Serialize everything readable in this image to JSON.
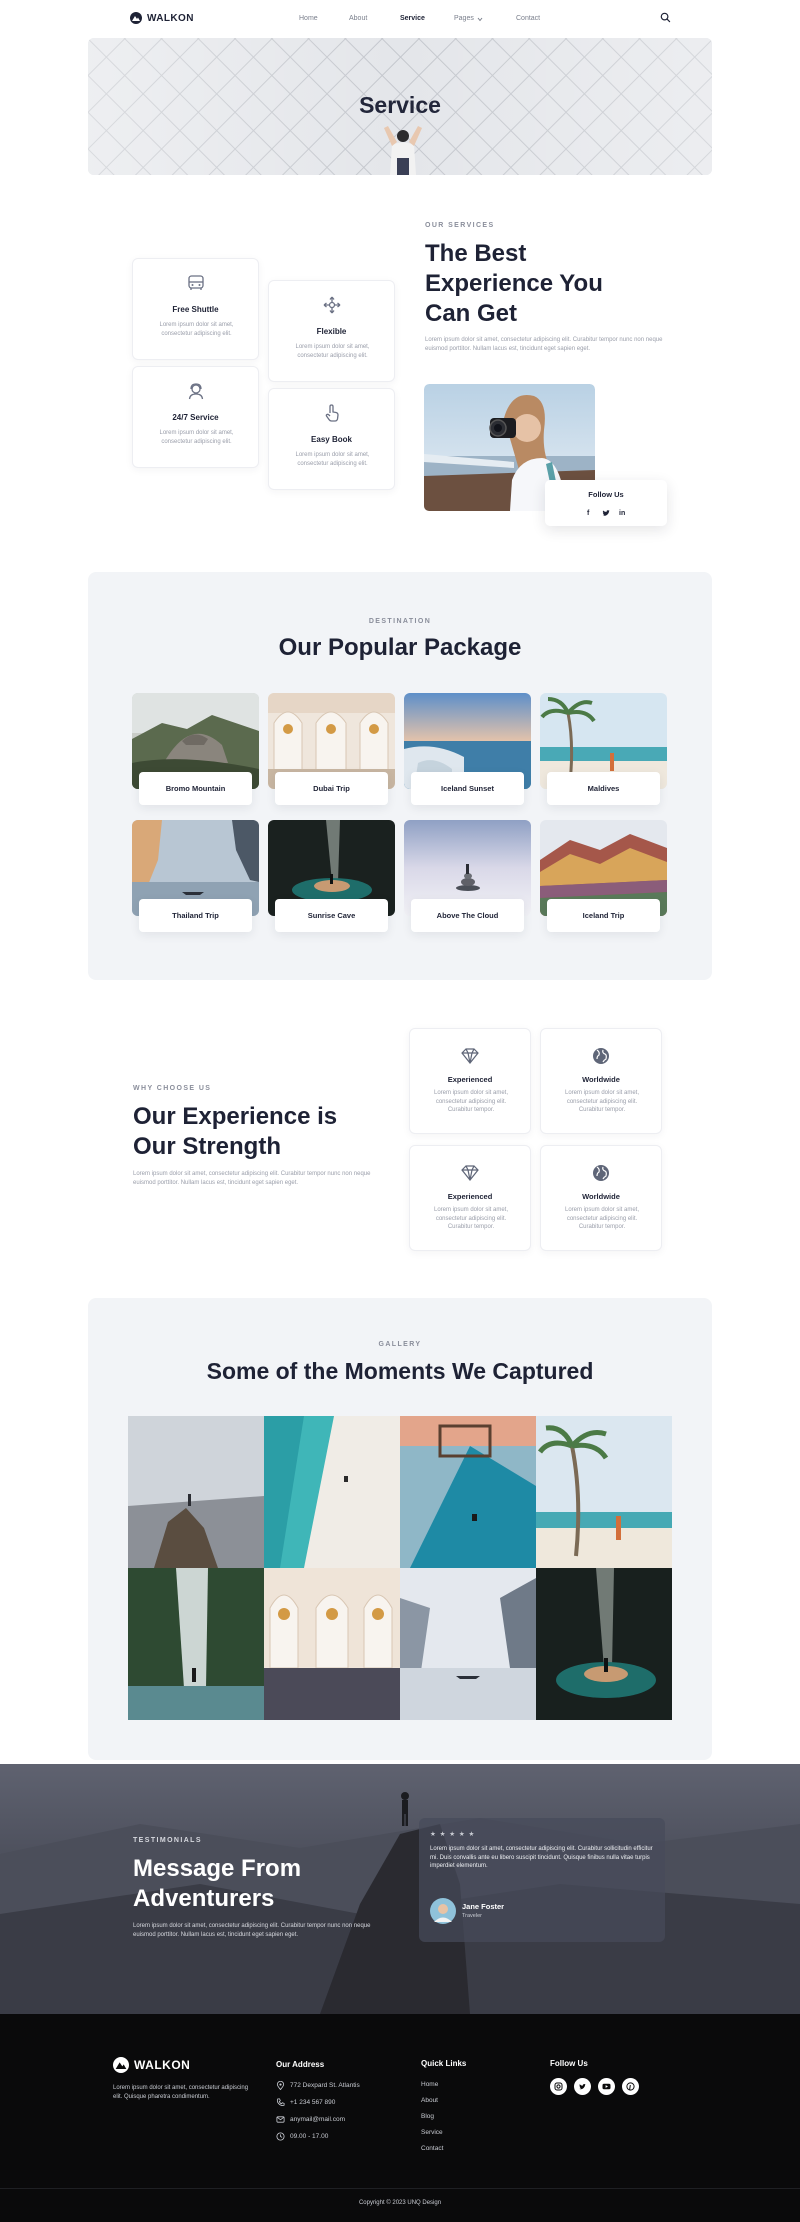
{
  "brand": {
    "name": "WALKON"
  },
  "nav": {
    "items": [
      "Home",
      "About",
      "Service",
      "Pages",
      "Contact"
    ],
    "active": "Service"
  },
  "hero": {
    "title": "Service"
  },
  "services": {
    "eyebrow": "OUR SERVICES",
    "title_lines": [
      "The Best",
      "Experience You",
      "Can Get"
    ],
    "description": "Lorem ipsum dolor sit amet, consectetur adipiscing elit. Curabitur tempor nunc non neque euismod porttitor. Nullam lacus est, tincidunt eget sapien eget.",
    "cards": [
      {
        "title": "Free Shuttle",
        "desc": "Lorem ipsum dolor sit amet, consectetur adipiscing elit.",
        "icon": "bus-icon"
      },
      {
        "title": "Flexible",
        "desc": "Lorem ipsum dolor sit amet, consectetur adipiscing elit.",
        "icon": "flexible-icon"
      },
      {
        "title": "24/7 Service",
        "desc": "Lorem ipsum dolor sit amet, consectetur adipiscing elit.",
        "icon": "support-agent-icon"
      },
      {
        "title": "Easy Book",
        "desc": "Lorem ipsum dolor sit amet, consectetur adipiscing elit.",
        "icon": "hand-tap-icon"
      }
    ],
    "follow": {
      "title": "Follow Us",
      "socials": [
        "f",
        "t",
        "in"
      ]
    }
  },
  "packages": {
    "eyebrow": "DESTINATION",
    "title": "Our Popular Package",
    "items": [
      "Bromo Mountain",
      "Dubai Trip",
      "Iceland Sunset",
      "Maldives",
      "Thailand Trip",
      "Sunrise Cave",
      "Above The Cloud",
      "Iceland Trip"
    ]
  },
  "why": {
    "eyebrow": "WHY CHOOSE US",
    "title_lines": [
      "Our Experience is",
      "Our Strength"
    ],
    "description": "Lorem ipsum dolor sit amet, consectetur adipiscing elit. Curabitur tempor nunc non neque euismod porttitor. Nullam lacus est, tincidunt eget sapien eget.",
    "cards": [
      {
        "title": "Experienced",
        "desc": "Lorem ipsum dolor sit amet, consectetur adipiscing elit. Curabitur tempor.",
        "icon": "diamond-icon"
      },
      {
        "title": "Worldwide",
        "desc": "Lorem ipsum dolor sit amet, consectetur adipiscing elit. Curabitur tempor.",
        "icon": "globe-icon"
      },
      {
        "title": "Experienced",
        "desc": "Lorem ipsum dolor sit amet, consectetur adipiscing elit. Curabitur tempor.",
        "icon": "diamond-icon"
      },
      {
        "title": "Worldwide",
        "desc": "Lorem ipsum dolor sit amet, consectetur adipiscing elit. Curabitur tempor.",
        "icon": "globe-icon"
      }
    ]
  },
  "gallery": {
    "eyebrow": "GALLERY",
    "title": "Some of the Moments We Captured"
  },
  "testimonials": {
    "eyebrow": "TESTIMONIALS",
    "title_lines": [
      "Message From",
      "Adventurers"
    ],
    "description": "Lorem ipsum dolor sit amet, consectetur adipiscing elit. Curabitur tempor nunc non neque euismod porttitor. Nullam lacus est, tincidunt eget sapien eget.",
    "stars": "★ ★ ★ ★ ★",
    "quote": "Lorem ipsum dolor sit amet, consectetur adipiscing elit. Curabitur sollicitudin efficitur mi. Duis convallis ante eu libero suscipit tincidunt. Quisque finibus nulla vitae turpis imperdiet elementum.",
    "author": "Jane Foster",
    "role": "Traveler"
  },
  "footer": {
    "brand_description": "Lorem ipsum dolor sit amet, consectetur adipiscing elit. Quisque pharetra condimentum.",
    "address_title": "Our Address",
    "address": [
      "772 Dexpard St. Atlantis",
      "+1 234 567 890",
      "anymail@mail.com",
      "09.00 - 17.00"
    ],
    "quick_links_title": "Quick Links",
    "quick_links": [
      "Home",
      "About",
      "Blog",
      "Service",
      "Contact"
    ],
    "follow_title": "Follow Us",
    "socials": [
      "ig",
      "tw",
      "yt",
      "ph"
    ],
    "copyright": "Copyright © 2023 UNQ Design"
  },
  "colors": {
    "navy": "#1e2235",
    "muted": "#9a9eaa",
    "panel": "#f2f4f7",
    "footer": "#0a0a0b"
  }
}
